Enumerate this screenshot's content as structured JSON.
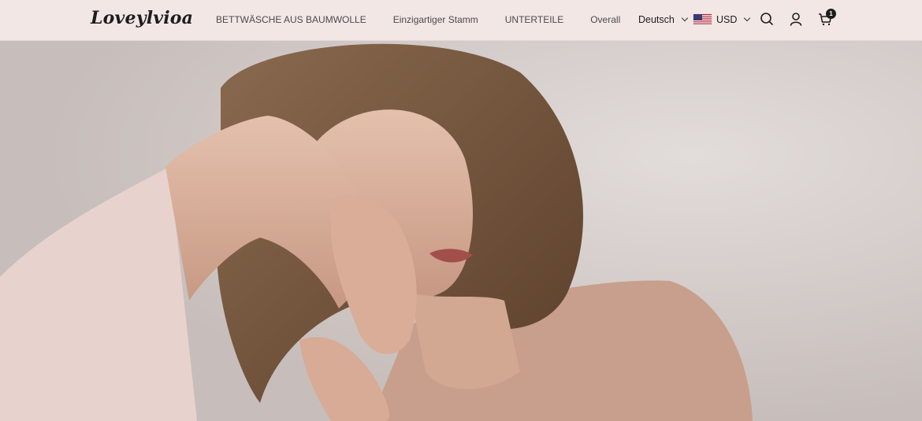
{
  "brand": {
    "logo_text": "Loveylvioa"
  },
  "nav": {
    "items": [
      {
        "label": "BETTWÄSCHE AUS BAUMWOLLE"
      },
      {
        "label": "Einzigartiger Stamm"
      },
      {
        "label": "UNTERTEILE"
      },
      {
        "label": "Overall"
      }
    ]
  },
  "utilities": {
    "language": "Deutsch",
    "currency": "USD",
    "cart_count": "1"
  },
  "hero": {
    "image": "woman-resting-head-on-hands-photo"
  },
  "colors": {
    "header_bg": "#f3e7e6",
    "text": "#1d1d1d"
  }
}
